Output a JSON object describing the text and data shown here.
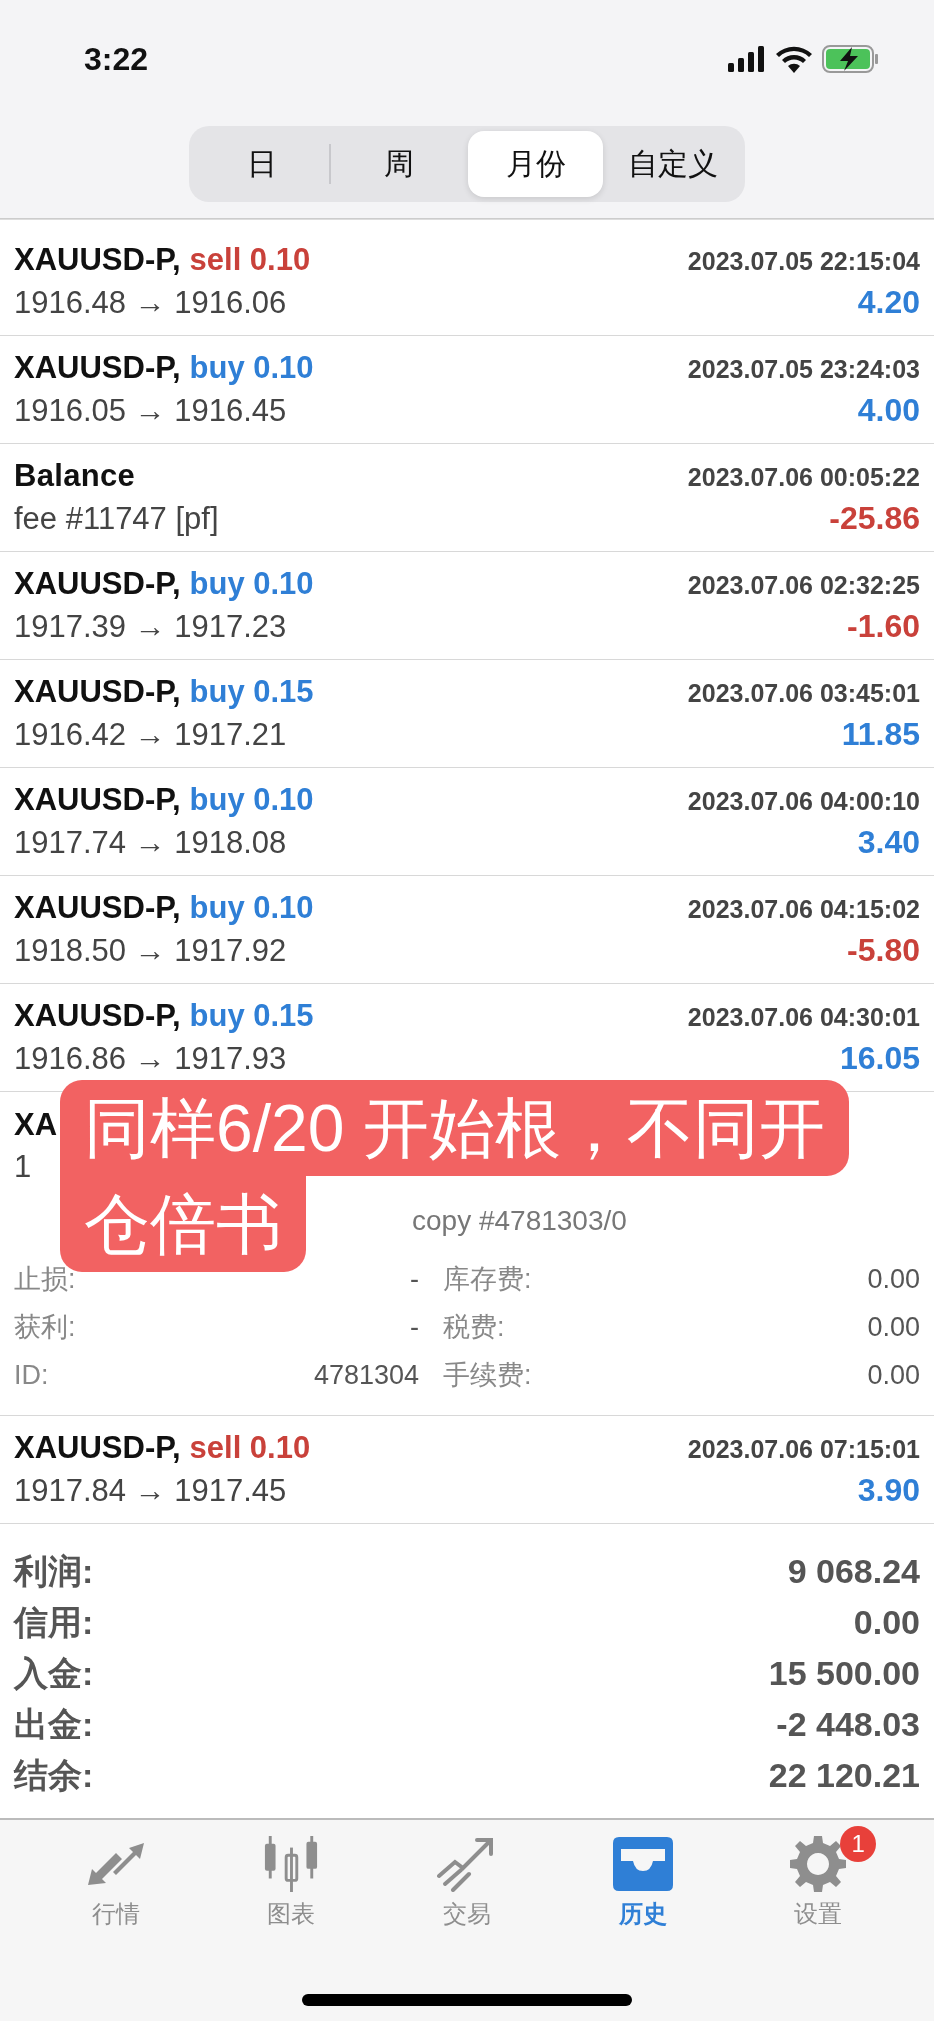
{
  "status_bar": {
    "time": "3:22"
  },
  "period_tabs": [
    {
      "label": "日",
      "selected": false
    },
    {
      "label": "周",
      "selected": false
    },
    {
      "label": "月份",
      "selected": true
    },
    {
      "label": "自定义",
      "selected": false
    }
  ],
  "trades": [
    {
      "symbol": "XAUUSD-P,",
      "kind": "sell",
      "side": "sell 0.10",
      "time": "2023.07.05 22:15:04",
      "prices": "1916.48 → 1916.06",
      "profit": "4.20",
      "loss": false
    },
    {
      "symbol": "XAUUSD-P,",
      "kind": "buy",
      "side": "buy 0.10",
      "time": "2023.07.05 23:24:03",
      "prices": "1916.05 → 1916.45",
      "profit": "4.00",
      "loss": false
    },
    {
      "symbol": "Balance",
      "kind": "balance",
      "time": "2023.07.06 00:05:22",
      "prices": "fee #11747 [pf]",
      "profit": "-25.86",
      "loss": true
    },
    {
      "symbol": "XAUUSD-P,",
      "kind": "buy",
      "side": "buy 0.10",
      "time": "2023.07.06 02:32:25",
      "prices": "1917.39 → 1917.23",
      "profit": "-1.60",
      "loss": true
    },
    {
      "symbol": "XAUUSD-P,",
      "kind": "buy",
      "side": "buy 0.15",
      "time": "2023.07.06 03:45:01",
      "prices": "1916.42 → 1917.21",
      "profit": "11.85",
      "loss": false
    },
    {
      "symbol": "XAUUSD-P,",
      "kind": "buy",
      "side": "buy 0.10",
      "time": "2023.07.06 04:00:10",
      "prices": "1917.74 → 1918.08",
      "profit": "3.40",
      "loss": false
    },
    {
      "symbol": "XAUUSD-P,",
      "kind": "buy",
      "side": "buy 0.10",
      "time": "2023.07.06 04:15:02",
      "prices": "1918.50 → 1917.92",
      "profit": "-5.80",
      "loss": true
    },
    {
      "symbol": "XAUUSD-P,",
      "kind": "buy",
      "side": "buy 0.15",
      "time": "2023.07.06 04:30:01",
      "prices": "1916.86 → 1917.93",
      "profit": "16.05",
      "loss": false
    }
  ],
  "expanded_trade": {
    "symbol": "XA",
    "prices": "1",
    "comment": "copy #4781303/0",
    "details": [
      {
        "left_label": "止损:",
        "left_value": "-",
        "right_label": "库存费:",
        "right_value": "0.00"
      },
      {
        "left_label": "获利:",
        "left_value": "-",
        "right_label": "税费:",
        "right_value": "0.00"
      },
      {
        "left_label": "ID:",
        "left_value": "4781304",
        "right_label": "手续费:",
        "right_value": "0.00"
      }
    ]
  },
  "annotation_lines": [
    "同样6/20 开始根，不同开",
    "仓倍书"
  ],
  "trades_after": [
    {
      "symbol": "XAUUSD-P,",
      "kind": "sell",
      "side": "sell 0.10",
      "time": "2023.07.06 07:15:01",
      "prices": "1917.84 → 1917.45",
      "profit": "3.90",
      "loss": false
    }
  ],
  "summary": [
    {
      "label": "利润:",
      "value": "9 068.24"
    },
    {
      "label": "信用:",
      "value": "0.00"
    },
    {
      "label": "入金:",
      "value": "15 500.00"
    },
    {
      "label": "出金:",
      "value": "-2 448.03"
    },
    {
      "label": "结余:",
      "value": "22 120.21"
    }
  ],
  "tab_bar": [
    {
      "label": "行情",
      "kind": "quotes",
      "selected": false
    },
    {
      "label": "图表",
      "kind": "chart",
      "selected": false
    },
    {
      "label": "交易",
      "kind": "trade",
      "selected": false
    },
    {
      "label": "历史",
      "kind": "history",
      "selected": true
    },
    {
      "label": "设置",
      "kind": "settings",
      "selected": false,
      "badge": "1"
    }
  ]
}
